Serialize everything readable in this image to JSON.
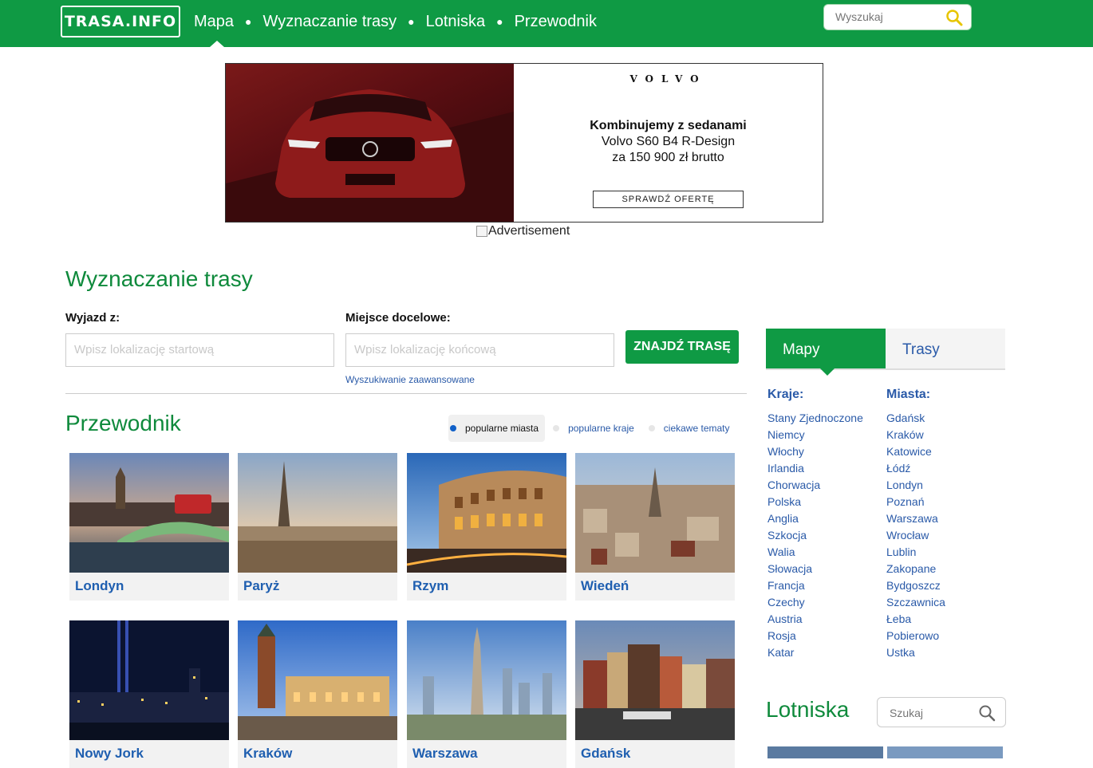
{
  "header": {
    "logo": "TRASA.INFO",
    "nav": [
      "Mapa",
      "Wyznaczanie trasy",
      "Lotniska",
      "Przewodnik"
    ],
    "search_placeholder": "Wyszukaj"
  },
  "ad": {
    "brand": "VOLVO",
    "line1": "Kombinujemy z sedanami",
    "line2": "Volvo S60 B4 R-Design",
    "line3": "za 150 900 zł brutto",
    "cta": "SPRAWDŹ OFERTĘ",
    "alt_text": "Advertisement"
  },
  "route": {
    "title": "Wyznaczanie trasy",
    "from_label": "Wyjazd z:",
    "from_placeholder": "Wpisz lokalizację startową",
    "to_label": "Miejsce docelowe:",
    "to_placeholder": "Wpisz lokalizację końcową",
    "button": "ZNAJDŹ TRASĘ",
    "advanced": "Wyszukiwanie zaawansowane"
  },
  "guide": {
    "title": "Przewodnik",
    "tabs": [
      "popularne miasta",
      "popularne kraje",
      "ciekawe tematy"
    ],
    "active_tab": "popularne miasta",
    "cities": [
      "Londyn",
      "Paryż",
      "Rzym",
      "Wiedeń",
      "Nowy Jork",
      "Kraków",
      "Warszawa",
      "Gdańsk"
    ]
  },
  "sidebar": {
    "tabs": [
      "Mapy",
      "Trasy"
    ],
    "active_tab": "Mapy",
    "countries_heading": "Kraje:",
    "countries": [
      "Stany Zjednoczone",
      "Niemcy",
      "Włochy",
      "Irlandia",
      "Chorwacja",
      "Polska",
      "Anglia",
      "Szkocja",
      "Walia",
      "Słowacja",
      "Francja",
      "Czechy",
      "Austria",
      "Rosja",
      "Katar"
    ],
    "cities_heading": "Miasta:",
    "cities": [
      "Gdańsk",
      "Kraków",
      "Katowice",
      "Łódź",
      "Londyn",
      "Poznań",
      "Warszawa",
      "Wrocław",
      "Lublin",
      "Zakopane",
      "Bydgoszcz",
      "Szczawnica",
      "Łeba",
      "Pobierowo",
      "Ustka"
    ],
    "airports_title": "Lotniska",
    "airports_search_placeholder": "Szukaj"
  },
  "colors": {
    "brand_green": "#0f9a44",
    "link_blue": "#2a5aa8",
    "title_green": "#0f8a3c"
  }
}
